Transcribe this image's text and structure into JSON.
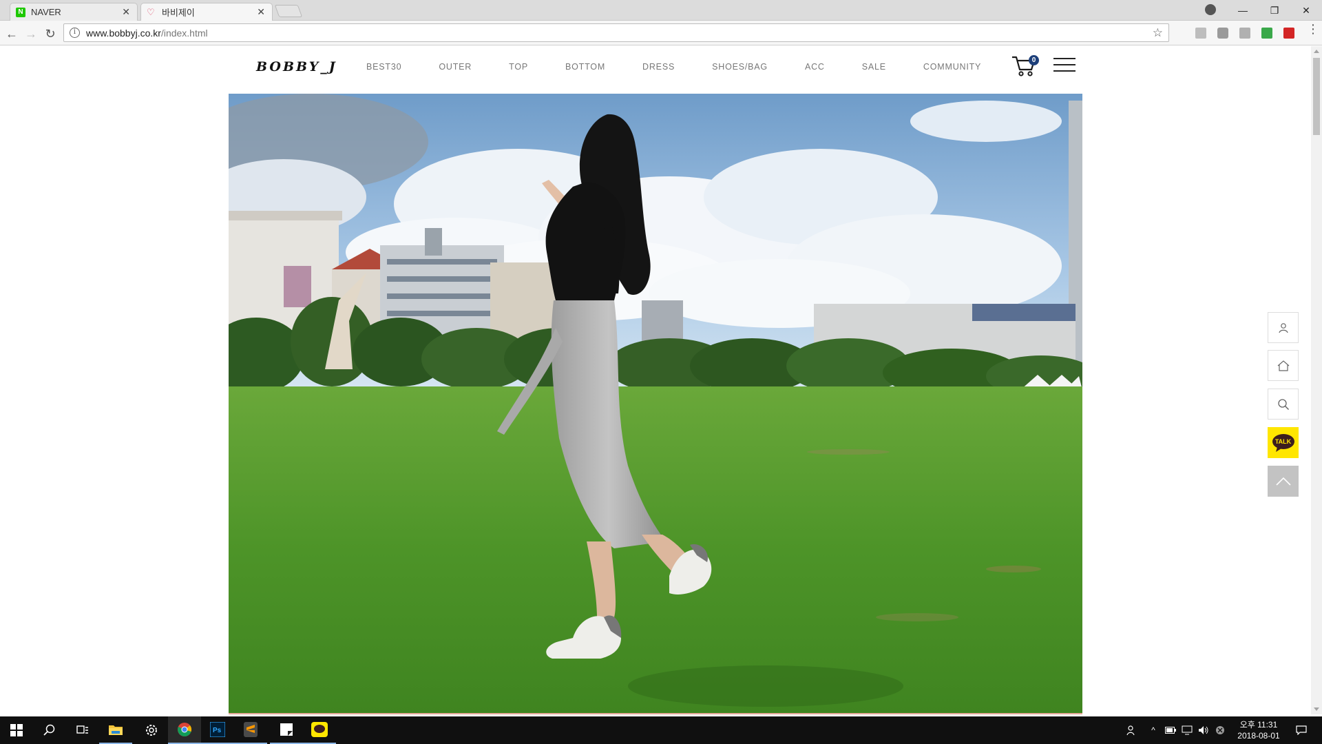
{
  "browser": {
    "tabs": [
      {
        "title": "NAVER",
        "favicon": "naver-icon"
      },
      {
        "title": "바비제이",
        "favicon": "heart-icon"
      }
    ],
    "url_domain": "www.bobbyj.co.kr",
    "url_path": "/index.html",
    "icons": [
      "back-arrow-icon",
      "forward-arrow-icon",
      "reload-icon",
      "info-icon",
      "bookmark-star-icon",
      "menu-kebab-icon",
      "account-icon",
      "minimize-icon",
      "restore-icon",
      "close-icon"
    ]
  },
  "site": {
    "logo": "BOBBY_J",
    "nav": [
      "BEST30",
      "OUTER",
      "TOP",
      "BOTTOM",
      "DRESS",
      "SHOES/BAG",
      "ACC",
      "SALE",
      "COMMUNITY"
    ],
    "cart_count": "0",
    "hero_alt": "woman in black top and grey wrap skirt walking on a grass lawn",
    "quick_menu": [
      "login-icon",
      "home-icon",
      "search-icon",
      "kakao-talk-icon",
      "scroll-top-icon"
    ],
    "talk_label": "TALK"
  },
  "taskbar": {
    "apps": [
      "windows-start-icon",
      "search-icon",
      "task-view-icon",
      "file-explorer-icon",
      "settings-icon",
      "chrome-icon",
      "photoshop-icon",
      "sublime-text-icon",
      "sticky-notes-icon",
      "kakaotalk-icon"
    ],
    "time": "오후 11:31",
    "date": "2018-08-01"
  },
  "colors": {
    "accent_navy": "#1d3f7a",
    "kakao_yellow": "#ffe600",
    "sky": "#8fb7dc",
    "grass": "#4f9a2e"
  }
}
